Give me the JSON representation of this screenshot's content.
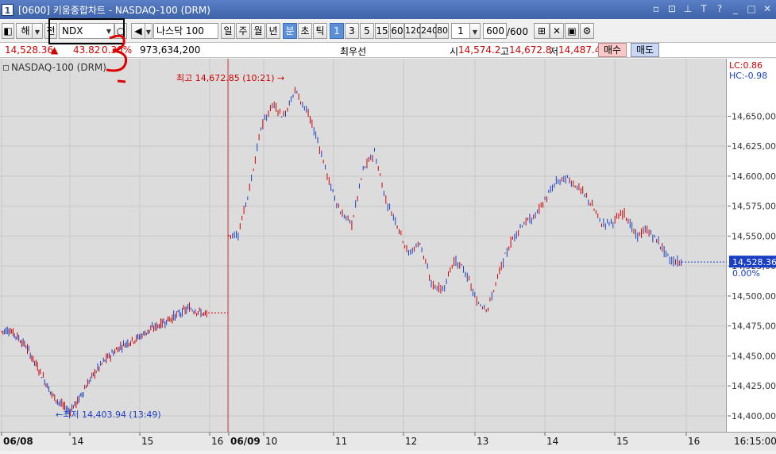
{
  "window": {
    "number": "1",
    "title": "[0600] 키움종합차트 - NASDAQ-100 (DRM)"
  },
  "toolbar": {
    "mode_label": "해",
    "all_label": "전",
    "symbol": "NDX",
    "symbol_name": "나스닥 100",
    "periods": [
      "일",
      "주",
      "월",
      "년",
      "분",
      "초",
      "틱"
    ],
    "selected_period": "분",
    "intervals": [
      "1",
      "3",
      "5",
      "15",
      "60",
      "120",
      "240",
      "80"
    ],
    "selected_interval": "1",
    "interval_value": "1",
    "count_value": "600",
    "count_total": "/600"
  },
  "quote": {
    "price": "14,528.36",
    "change_arrow": "▲",
    "change": "43.82",
    "change_pct": "0.30%",
    "volume": "973,634,200",
    "best_label": "최우선",
    "open_label": "시",
    "open": "14,574.2",
    "high_label": "고",
    "high": "14,672.8",
    "low_label": "저",
    "low": "14,487.4",
    "buy_label": "매수",
    "sell_label": "매도"
  },
  "chart_data": {
    "type": "candlestick",
    "title": "NASDAQ-100 (DRM)",
    "colors": {
      "up": "#d00000",
      "down": "#1a3fc4",
      "background": "#dcdcdc"
    },
    "y_ticks": [
      "14,650,00",
      "14,625,00",
      "14,600,00",
      "14,575,00",
      "14,550,00",
      "14,525,00",
      "14,500,00",
      "14,475,00",
      "14,450,00",
      "14,425,00",
      "14,400,00"
    ],
    "ylim": [
      14396,
      14690
    ],
    "x_ticks": [
      "06/08",
      "14",
      "15",
      "16",
      "06/09",
      "10",
      "11",
      "12",
      "13",
      "14",
      "15",
      "16"
    ],
    "x_tick_last": "16:15:00",
    "lc_label": "LC:0.86",
    "hc_label": "HC:-0.98",
    "current_price_label": "14,528.36",
    "current_pct_label": "0.00%",
    "max_annotation": "최고 14,672.85 (10:21)",
    "min_annotation": "최저 14,403.94 (13:49)",
    "day1_closes": [
      14472,
      14466,
      14458,
      14445,
      14432,
      14418,
      14410,
      14404,
      14412,
      14425,
      14436,
      14445,
      14452,
      14458,
      14462,
      14465,
      14470,
      14474,
      14478,
      14482,
      14486,
      14490,
      14487,
      14484
    ],
    "day2_closes": [
      14552,
      14590,
      14640,
      14660,
      14650,
      14672,
      14655,
      14630,
      14595,
      14570,
      14560,
      14605,
      14620,
      14580,
      14560,
      14535,
      14545,
      14510,
      14505,
      14530,
      14520,
      14495,
      14490,
      14520,
      14545,
      14560,
      14565,
      14580,
      14595,
      14598,
      14590,
      14578,
      14560,
      14562,
      14570,
      14550,
      14555,
      14545,
      14530,
      14528
    ]
  },
  "annotation": {
    "handwritten_text": "3"
  }
}
